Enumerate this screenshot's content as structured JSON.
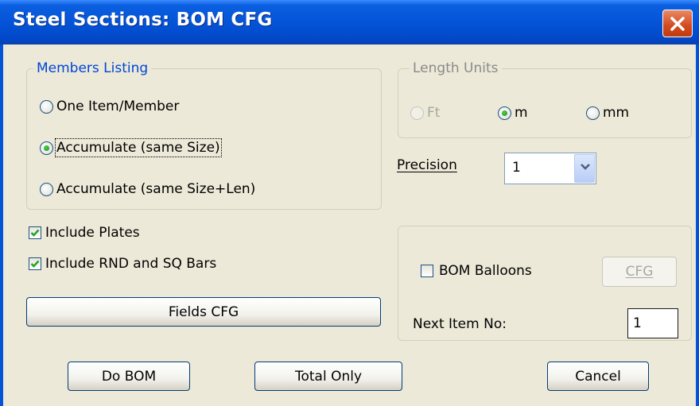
{
  "window": {
    "title": "Steel Sections: BOM CFG",
    "close_icon": "close-icon"
  },
  "members_listing": {
    "title": "Members Listing",
    "options": [
      {
        "label": "One Item/Member",
        "selected": false
      },
      {
        "label": "Accumulate (same Size)",
        "selected": true
      },
      {
        "label": "Accumulate (same Size+Len)",
        "selected": false
      }
    ]
  },
  "length_units": {
    "title": "Length Units",
    "options": [
      {
        "label": "Ft",
        "selected": false,
        "disabled": true
      },
      {
        "label": "m",
        "selected": true,
        "disabled": false
      },
      {
        "label": "mm",
        "selected": false,
        "disabled": false
      }
    ]
  },
  "precision": {
    "label": "Precision",
    "value": "1"
  },
  "include_plates": {
    "label": "Include Plates",
    "checked": true
  },
  "include_bars": {
    "label": "Include RND and SQ Bars",
    "checked": true
  },
  "fields_cfg_button": "Fields CFG",
  "bom_balloons": {
    "label": "BOM Balloons",
    "checked": false,
    "cfg_button": "CFG"
  },
  "next_item": {
    "label": "Next Item No:",
    "value": "1"
  },
  "buttons": {
    "do_bom": "Do BOM",
    "total_only": "Total Only",
    "cancel": "Cancel"
  },
  "colors": {
    "titlebar": "#0554d8",
    "dialog_bg": "#ece9d8",
    "group_title": "#0046d5",
    "check_mark": "#21a121",
    "close_button": "#d24a1e"
  }
}
